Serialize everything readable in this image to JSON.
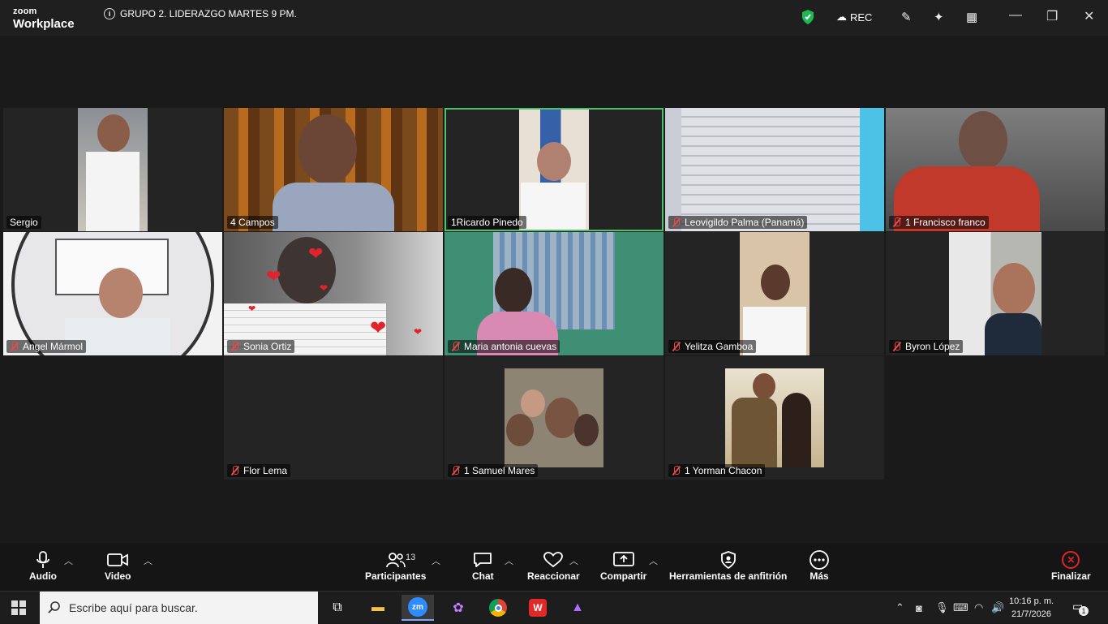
{
  "app": {
    "logo_top": "zoom",
    "logo_bottom": "Workplace",
    "meeting_title": "GRUPO 2. LIDERAZGO MARTES 9 PM.",
    "rec_label": "REC"
  },
  "participants": [
    {
      "name": "Sergio",
      "muted": false
    },
    {
      "name": "4 Campos",
      "muted": false
    },
    {
      "name": "1Ricardo Pinedo",
      "muted": false,
      "active_speaker": true
    },
    {
      "name": "Leovigildo Palma (Panamá)",
      "muted": true
    },
    {
      "name": "1 Francisco franco",
      "muted": true
    },
    {
      "name": "Angel Mármol",
      "muted": true
    },
    {
      "name": "Sonia Ortiz",
      "muted": true
    },
    {
      "name": "Maria antonia cuevas",
      "muted": true
    },
    {
      "name": "Yelitza Gamboa",
      "muted": true
    },
    {
      "name": "Byron López",
      "muted": true
    },
    {
      "name": "Flor Lema",
      "muted": true
    },
    {
      "name": "1 Samuel Mares",
      "muted": true
    },
    {
      "name": "1 Yorman Chacon",
      "muted": true
    }
  ],
  "toolbar": {
    "audio": "Audio",
    "video": "Video",
    "participants": "Participantes",
    "participants_count": "13",
    "chat": "Chat",
    "react": "Reaccionar",
    "share": "Compartir",
    "host_tools": "Herramientas de anfitrión",
    "more": "Más",
    "end": "Finalizar"
  },
  "taskbar": {
    "search_placeholder": "Escribe aquí para buscar.",
    "time": "10:16 p. m.",
    "date": "21/7/2026",
    "notifications": "1",
    "zoom_app": "zm"
  },
  "colors": {
    "active_border": "#4cc36a",
    "end_red": "#e0242e",
    "shield_green": "#1db954"
  }
}
